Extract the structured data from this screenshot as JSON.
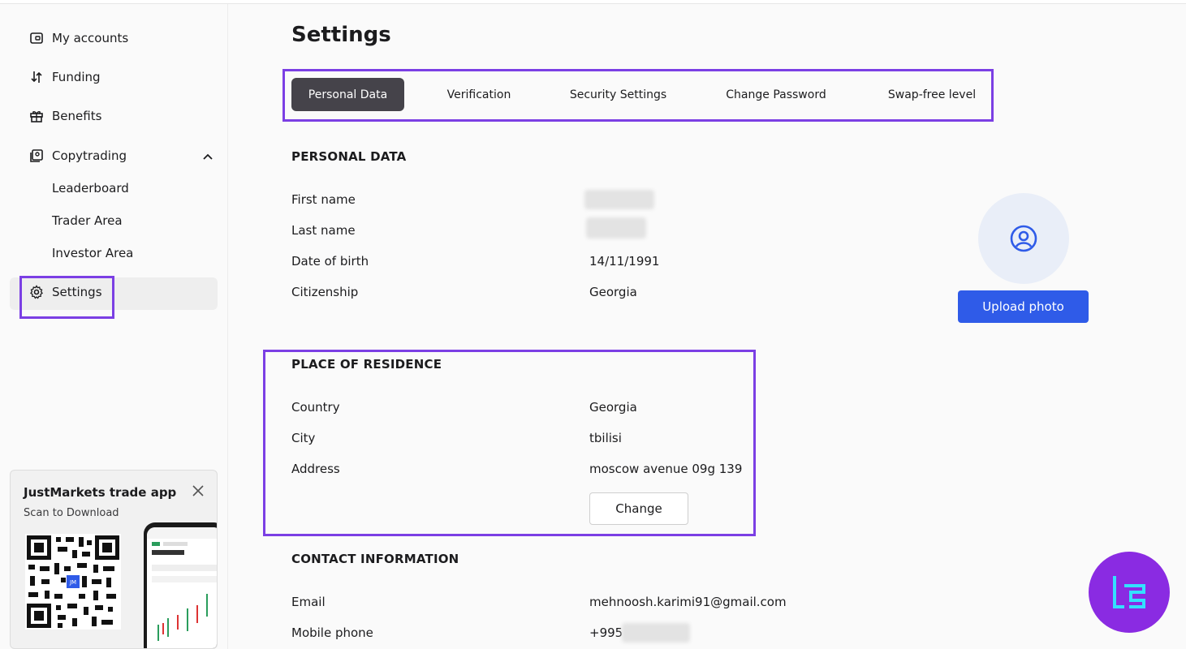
{
  "sidebar": {
    "items": [
      {
        "label": "My accounts",
        "icon": "wallet-icon"
      },
      {
        "label": "Funding",
        "icon": "transfer-arrows-icon"
      },
      {
        "label": "Benefits",
        "icon": "gift-icon"
      },
      {
        "label": "Copytrading",
        "icon": "copytrading-icon"
      }
    ],
    "copytrading_sub": [
      "Leaderboard",
      "Trader Area",
      "Investor Area"
    ],
    "settings_label": "Settings",
    "settings_icon": "gear-icon"
  },
  "promo": {
    "title": "JustMarkets trade app",
    "subtitle": "Scan to Download",
    "qr_badge": "JM"
  },
  "page": {
    "title": "Settings"
  },
  "tabs": [
    {
      "label": "Personal Data",
      "active": true
    },
    {
      "label": "Verification",
      "active": false
    },
    {
      "label": "Security Settings",
      "active": false
    },
    {
      "label": "Change Password",
      "active": false
    },
    {
      "label": "Swap-free level",
      "active": false
    }
  ],
  "personal_data": {
    "title": "PERSONAL DATA",
    "rows": [
      {
        "label": "First name",
        "value": ""
      },
      {
        "label": "Last name",
        "value": ""
      },
      {
        "label": "Date of birth",
        "value": "14/11/1991"
      },
      {
        "label": "Citizenship",
        "value": "Georgia"
      }
    ]
  },
  "residence": {
    "title": "PLACE OF RESIDENCE",
    "rows": [
      {
        "label": "Country",
        "value": "Georgia"
      },
      {
        "label": "City",
        "value": "tbilisi"
      },
      {
        "label": "Address",
        "value": "moscow avenue 09g 139"
      }
    ],
    "change_label": "Change"
  },
  "contact": {
    "title": "CONTACT INFORMATION",
    "rows": [
      {
        "label": "Email",
        "value": "mehnoosh.karimi91@gmail.com"
      },
      {
        "label": "Mobile phone",
        "value": "+995"
      }
    ]
  },
  "photo": {
    "upload_label": "Upload photo",
    "avatar_icon": "user-circle-icon"
  },
  "colors": {
    "highlight": "#7b3fe4",
    "primary_button": "#2f5be8",
    "active_tab": "#45434a",
    "brand_badge": "#8a2be2",
    "brand_glyph": "#33e0ff"
  }
}
